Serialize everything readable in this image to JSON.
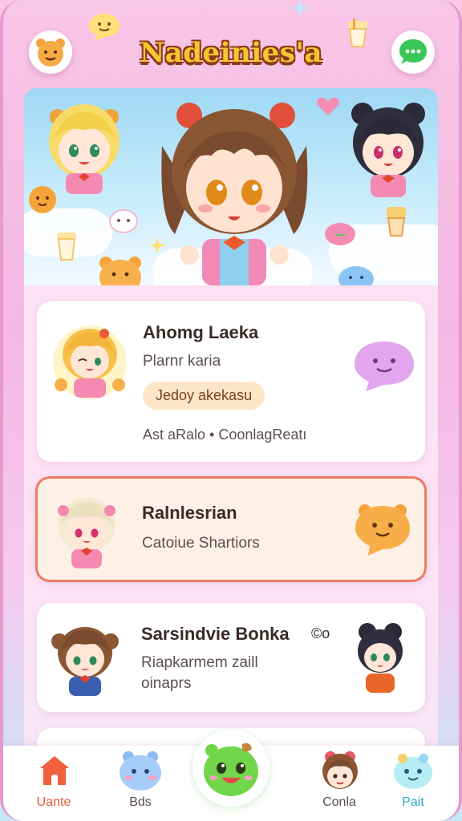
{
  "header": {
    "title": "Nadeinies'a",
    "left_icon": "bear-face-icon",
    "right_icon": "chat-bubble-icon"
  },
  "banner": {
    "characters": [
      "blonde-girl-avatar",
      "brown-hair-girl-avatar",
      "black-hair-girl-avatar"
    ]
  },
  "cards": [
    {
      "name": "Ahomg Laeka",
      "subtitle": "Plarnr karia",
      "chip": "Jedoy akekasu",
      "footer": "Ast aRalo • CoonlagReatı",
      "icon": "purple-chat-bubble-icon",
      "selected": false
    },
    {
      "name": "Ralnlesrian",
      "subtitle": "Catoiue Shartiors",
      "icon": "orange-bear-bubble-icon",
      "selected": true
    },
    {
      "name": "Sarsindvie Bonka",
      "badge": "©o",
      "subtitle_line1": "Riapkarmem zaill",
      "subtitle_line2": "oinaprs",
      "icon": "black-hair-girl-avatar",
      "selected": false
    }
  ],
  "tabs": [
    {
      "label": "Uante",
      "icon": "house-icon",
      "active": true
    },
    {
      "label": "Bds",
      "icon": "blue-blob-icon",
      "active": false
    },
    {
      "label": "",
      "icon": "green-mascot-icon",
      "active": false
    },
    {
      "label": "Conla",
      "icon": "girl-face-icon",
      "active": false
    },
    {
      "label": "Pait",
      "icon": "cyan-blob-icon",
      "active": false
    }
  ],
  "colors": {
    "accent": "#ec7c62",
    "title_fill": "#f7c531",
    "title_outline": "#8a3a1a",
    "chip_bg": "#fde6c7",
    "active_tab": "#e05a3a"
  }
}
